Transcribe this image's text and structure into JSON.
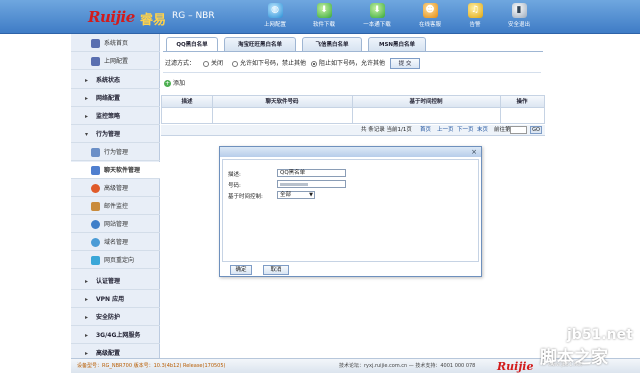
{
  "header": {
    "logo": "Ruijie",
    "logo_cn": "睿易",
    "product": "RG – NBR",
    "toolbar": [
      {
        "label": "上网配置",
        "icon": "globe-icon",
        "color": "#46b0e8"
      },
      {
        "label": "软件下载",
        "icon": "download-icon",
        "color": "#3fae3a"
      },
      {
        "label": "一本通下载",
        "icon": "download-icon",
        "color": "#3fae3a"
      },
      {
        "label": "在线客服",
        "icon": "people-icon",
        "color": "#f2a21c"
      },
      {
        "label": "告警",
        "icon": "bell-icon",
        "color": "#f2c11c"
      },
      {
        "label": "安全退出",
        "icon": "exit-icon",
        "color": "#e8e8e8"
      }
    ]
  },
  "sidebar": {
    "items": [
      {
        "label": "系统首页",
        "kind": "sub",
        "icon": "monitor-icon"
      },
      {
        "label": "上网配置",
        "kind": "sub",
        "icon": "monitor-icon"
      },
      {
        "label": "系统状态",
        "kind": "sec"
      },
      {
        "label": "网络配置",
        "kind": "sec"
      },
      {
        "label": "监控策略",
        "kind": "sec"
      },
      {
        "label": "行为管理",
        "kind": "sec-open"
      },
      {
        "label": "行为管理",
        "kind": "sub",
        "icon": "stats-icon"
      },
      {
        "label": "聊天软件管理",
        "kind": "sub",
        "icon": "chat-icon",
        "active": true
      },
      {
        "label": "高级管理",
        "kind": "sub",
        "icon": "advanced-icon"
      },
      {
        "label": "邮件监控",
        "kind": "sub",
        "icon": "mail-icon"
      },
      {
        "label": "网站管理",
        "kind": "sub",
        "icon": "website-icon"
      },
      {
        "label": "域名管理",
        "kind": "sub",
        "icon": "domain-icon"
      },
      {
        "label": "网页重定向",
        "kind": "sub",
        "icon": "redirect-icon"
      },
      {
        "label": "认证管理",
        "kind": "sec"
      },
      {
        "label": "VPN 应用",
        "kind": "sec"
      },
      {
        "label": "安全防护",
        "kind": "sec"
      },
      {
        "label": "3G/4G上网服务",
        "kind": "sec"
      },
      {
        "label": "高级配置",
        "kind": "sec"
      }
    ]
  },
  "tabs": [
    {
      "label": "QQ黑白名单",
      "active": true
    },
    {
      "label": "淘宝旺旺黑白名单"
    },
    {
      "label": "飞信黑白名单"
    },
    {
      "label": "MSN黑白名单"
    }
  ],
  "filter": {
    "label": "过滤方式：",
    "options": [
      "关闭",
      "允许如下号码，禁止其他",
      "阻止如下号码，允许其他"
    ],
    "selected_index": 2,
    "submit": "提 交"
  },
  "add_label": "添加",
  "table": {
    "columns": [
      "描述",
      "聊天软件号码",
      "基于时间控制",
      "操作"
    ]
  },
  "pager": {
    "summary": "共 条记录 当前1/1页",
    "first": "首页",
    "prev": "上一页",
    "next": "下一页",
    "last": "末页",
    "goto_label": "前往第",
    "page_unit": "页",
    "go": "GO"
  },
  "dialog": {
    "desc_label": "描述:",
    "desc_value": "QQ黑名单",
    "number_label": "号码:",
    "number_value": "",
    "time_label": "基于时间控制:",
    "time_value": "全部",
    "ok": "确定",
    "cancel": "取消"
  },
  "footer": {
    "left": "设备型号：RG_NBR700  版本号：10.3(4b12) Release(170505)",
    "right": "技术论坛：ryxj.ruijie.com.cn — 技术支持：4001 000 078"
  },
  "watermark": {
    "site": "jb51.net",
    "cn": "脚本之家",
    "url": "www.jb51.net"
  },
  "colors": {
    "header": "#4a86cc",
    "brand_red": "#d21b1b",
    "sidebar_bg": "#e8eef7"
  }
}
